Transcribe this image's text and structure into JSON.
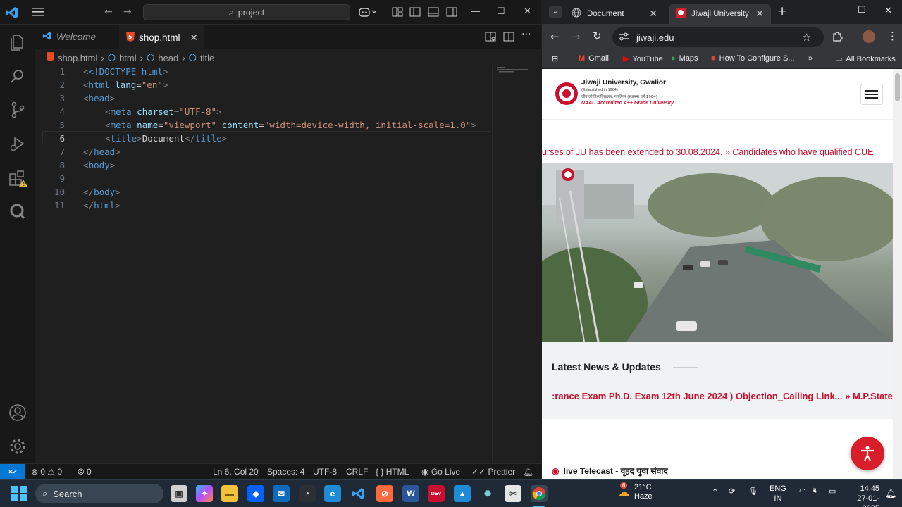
{
  "vscode": {
    "search_text": "project",
    "tabs": [
      {
        "label": "Welcome",
        "active": false
      },
      {
        "label": "shop.html",
        "active": true
      }
    ],
    "breadcrumb": [
      "shop.html",
      "html",
      "head",
      "title"
    ],
    "line_numbers": [
      "1",
      "2",
      "3",
      "4",
      "5",
      "6",
      "7",
      "8",
      "9",
      "10",
      "11"
    ],
    "current_line": 6,
    "status": {
      "errors": "0",
      "warnings": "0",
      "ports": "0",
      "position": "Ln 6, Col 20",
      "spaces": "Spaces: 4",
      "encoding": "UTF-8",
      "eol": "CRLF",
      "language": "HTML",
      "golive": "Go Live",
      "prettier": "Prettier"
    },
    "accent": "#0078d4"
  },
  "code": {
    "doctype": "<!DOCTYPE",
    "html": "html",
    "lang_attr": "lang",
    "lang_val": "\"en\"",
    "head": "head",
    "meta": "meta",
    "charset_attr": "charset",
    "charset_val": "\"UTF-8\"",
    "name_attr": "name",
    "name_val": "\"viewport\"",
    "content_attr": "content",
    "content_val": "\"width=device-width, initial-scale=1.0\"",
    "title": "title",
    "title_text": "Document",
    "body": "body"
  },
  "chrome": {
    "tabs": [
      {
        "label": "Document",
        "active": false
      },
      {
        "label": "Jiwaji University",
        "active": true
      }
    ],
    "url": "jiwaji.edu",
    "bookmarks": [
      "Gmail",
      "YouTube",
      "Maps",
      "How To Configure S...",
      "All Bookmarks"
    ],
    "page": {
      "logo_title": "Jiwaji University, Gwalior",
      "logo_established": "(Established in 1964)",
      "logo_hindi": "जीवाजी विश्वविद्यालय, ग्वालियर (स्थापना वर्ष 1964)",
      "logo_naac": "NAAC Accredited A++ Grade University",
      "ticker": "urses of JU has been extended to 30.08.2024.  »  Candidates who have qualified CUE",
      "news_title": "Latest News & Updates",
      "news_ticker": ":rance Exam Ph.D. Exam 12th June 2024 ) Objection_Calling Link...  »  M.P.State",
      "live": "live Telecast - वृहद युवा संवाद"
    },
    "brand_red": "#c8102e"
  },
  "taskbar": {
    "search": "Search",
    "weather_temp": "21°C",
    "weather_desc": "Haze",
    "weather_badge": "6",
    "lang": "ENG",
    "region": "IN",
    "time": "14:45",
    "date": "27-01-2025"
  }
}
